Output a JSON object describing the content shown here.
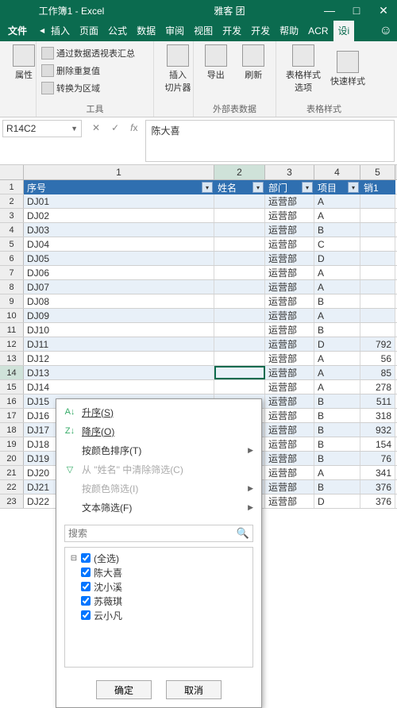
{
  "titlebar": {
    "doc": "工作簿1 - Excel",
    "center": "雅客    团"
  },
  "tabs": {
    "file": "文件",
    "list": [
      "插入",
      "页面",
      "公式",
      "数据",
      "审阅",
      "视图",
      "开发",
      "开发",
      "帮助",
      "ACR"
    ],
    "active": "设i"
  },
  "ribbon": {
    "g1": {
      "prop": "属性",
      "a": "通过数据透视表汇总",
      "b": "删除重复值",
      "c": "转换为区域",
      "cap": "工具"
    },
    "g2": {
      "slicer": "插入\n切片器"
    },
    "g3": {
      "export": "导出",
      "refresh": "刷新",
      "cap": "外部表数据"
    },
    "g4": {
      "styleopt": "表格样式\n选项",
      "quick": "快速样式",
      "cap": "表格样式"
    }
  },
  "fx": {
    "name": "R14C2",
    "value": "陈大喜"
  },
  "headers": {
    "c1": "序号",
    "c2": "姓名",
    "c3": "部门",
    "c4": "项目",
    "c5": "销1"
  },
  "cols": [
    "1",
    "2",
    "3",
    "4",
    "5"
  ],
  "rows": [
    {
      "n": "DJ01",
      "dept": "运营部",
      "proj": "A",
      "sale": ""
    },
    {
      "n": "DJ02",
      "dept": "运营部",
      "proj": "A",
      "sale": ""
    },
    {
      "n": "DJ03",
      "dept": "运营部",
      "proj": "B",
      "sale": ""
    },
    {
      "n": "DJ04",
      "dept": "运营部",
      "proj": "C",
      "sale": ""
    },
    {
      "n": "DJ05",
      "dept": "运营部",
      "proj": "D",
      "sale": ""
    },
    {
      "n": "DJ06",
      "dept": "运营部",
      "proj": "A",
      "sale": ""
    },
    {
      "n": "DJ07",
      "dept": "运营部",
      "proj": "A",
      "sale": ""
    },
    {
      "n": "DJ08",
      "dept": "运营部",
      "proj": "B",
      "sale": ""
    },
    {
      "n": "DJ09",
      "dept": "运营部",
      "proj": "A",
      "sale": ""
    },
    {
      "n": "DJ10",
      "dept": "运营部",
      "proj": "B",
      "sale": ""
    },
    {
      "n": "DJ11",
      "dept": "运营部",
      "proj": "D",
      "sale": "792"
    },
    {
      "n": "DJ12",
      "dept": "运营部",
      "proj": "A",
      "sale": "56"
    },
    {
      "n": "DJ13",
      "dept": "运营部",
      "proj": "A",
      "sale": "85"
    },
    {
      "n": "DJ14",
      "dept": "运营部",
      "proj": "A",
      "sale": "278"
    },
    {
      "n": "DJ15",
      "dept": "运营部",
      "proj": "B",
      "sale": "511"
    },
    {
      "n": "DJ16",
      "dept": "运营部",
      "proj": "B",
      "sale": "318"
    },
    {
      "n": "DJ17",
      "dept": "运营部",
      "proj": "B",
      "sale": "932"
    },
    {
      "n": "DJ18",
      "dept": "运营部",
      "proj": "B",
      "sale": "154"
    },
    {
      "n": "DJ19",
      "dept": "运营部",
      "proj": "B",
      "sale": "76"
    },
    {
      "n": "DJ20",
      "dept": "运营部",
      "proj": "A",
      "sale": "341"
    },
    {
      "n": "DJ21",
      "dept": "运营部",
      "proj": "B",
      "sale": "376"
    },
    {
      "n": "DJ22",
      "dept": "运营部",
      "proj": "D",
      "sale": "376"
    }
  ],
  "filter": {
    "asc": "升序(S)",
    "desc": "降序(O)",
    "bycolor": "按颜色排序(T)",
    "clear": "从 \"姓名\" 中清除筛选(C)",
    "filtercolor": "按颜色筛选(I)",
    "textfilter": "文本筛选(F)",
    "search_ph": "搜索",
    "all": "(全选)",
    "items": [
      "陈大喜",
      "沈小溪",
      "苏薇琪",
      "云小凡"
    ],
    "ok": "确定",
    "cancel": "取消"
  }
}
